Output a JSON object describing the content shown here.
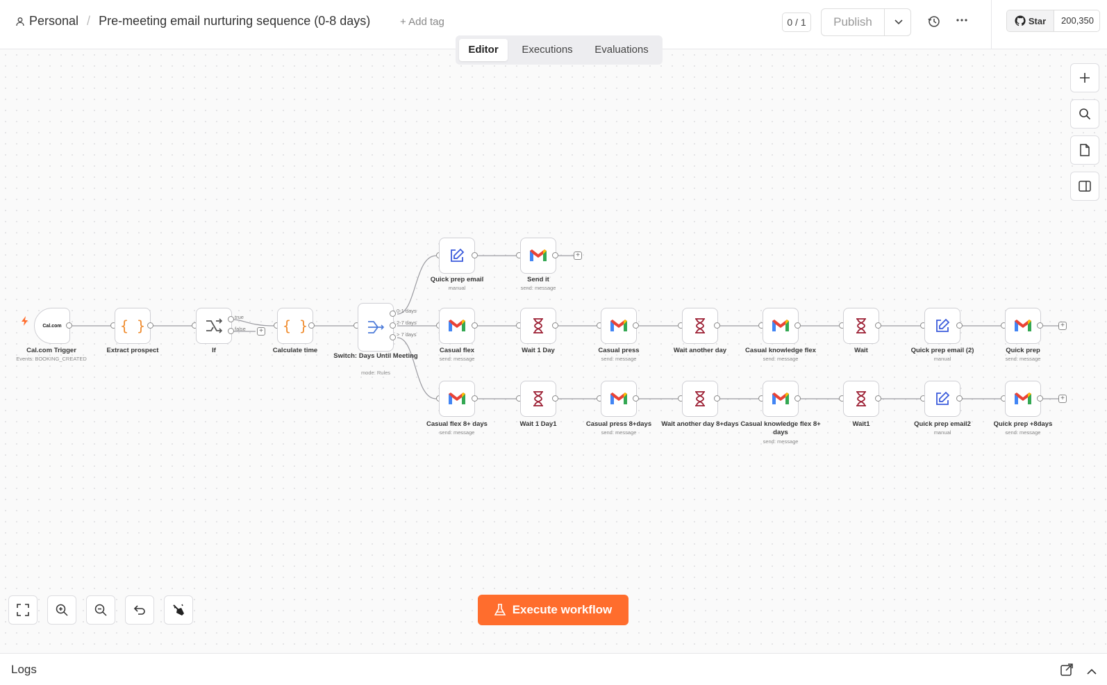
{
  "header": {
    "project": "Personal",
    "workflow_title": "Pre-meeting email nurturing sequence (0-8 days)",
    "add_tag": "+ Add tag",
    "counter": "0 / 1",
    "publish": "Publish",
    "star": "Star",
    "star_count": "200,350"
  },
  "tabs": [
    "Editor",
    "Executions",
    "Evaluations"
  ],
  "nodes": {
    "trigger": {
      "label": "Cal.com Trigger",
      "sub": "Events: BOOKING_CREATED",
      "logo": "Cal.com"
    },
    "extract": {
      "label": "Extract prospect"
    },
    "if": {
      "label": "If",
      "true_label": "true",
      "false_label": "false"
    },
    "calc": {
      "label": "Calculate time"
    },
    "switch": {
      "label": "Switch: Days Until Meeting",
      "sub": "mode: Rules",
      "out1": "0-1 days",
      "out2": "2-7 days",
      "out3": "> 7 days"
    },
    "row1": [
      {
        "label": "Quick prep email",
        "sub": "manual"
      },
      {
        "label": "Send it",
        "sub": "send: message"
      }
    ],
    "row2": [
      {
        "label": "Casual flex",
        "sub": "send: message"
      },
      {
        "label": "Wait 1 Day",
        "sub": ""
      },
      {
        "label": "Casual press",
        "sub": "send: message"
      },
      {
        "label": "Wait another day",
        "sub": ""
      },
      {
        "label": "Casual knowledge flex",
        "sub": "send: message"
      },
      {
        "label": "Wait",
        "sub": ""
      },
      {
        "label": "Quick prep email (2)",
        "sub": "manual"
      },
      {
        "label": "Quick prep",
        "sub": "send: message"
      }
    ],
    "row3": [
      {
        "label": "Casual flex 8+ days",
        "sub": "send: message"
      },
      {
        "label": "Wait 1 Day1",
        "sub": ""
      },
      {
        "label": "Casual press 8+days",
        "sub": "send: message"
      },
      {
        "label": "Wait another day 8+days",
        "sub": ""
      },
      {
        "label": "Casual knowledge flex 8+ days",
        "sub": "send: message"
      },
      {
        "label": "Wait1",
        "sub": ""
      },
      {
        "label": "Quick prep email2",
        "sub": "manual"
      },
      {
        "label": "Quick prep +8days",
        "sub": "send: message"
      }
    ]
  },
  "execute_button": "Execute workflow",
  "logs_label": "Logs",
  "colors": {
    "accent": "#ff6d2d",
    "wait": "#9b1c31",
    "edit": "#3b5bdb",
    "code": "#f08c2e",
    "switch": "#4c7bd9"
  }
}
